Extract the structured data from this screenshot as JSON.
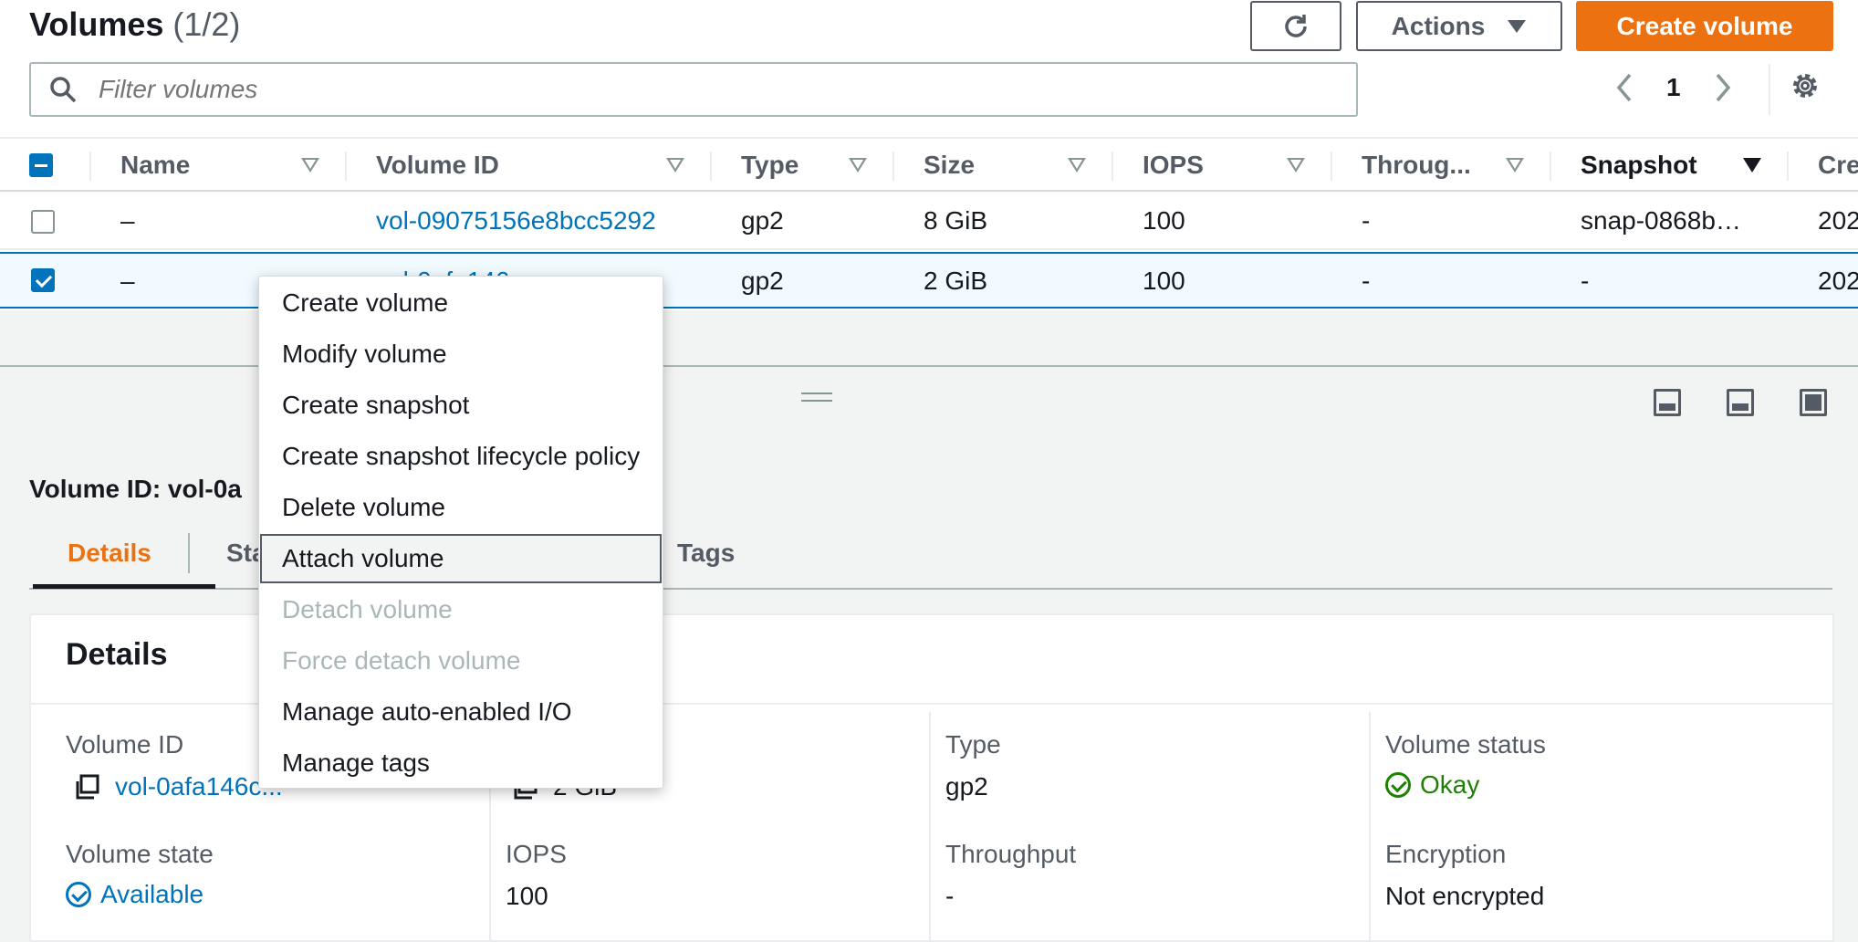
{
  "header": {
    "title": "Volumes",
    "count": "(1/2)",
    "actions_label": "Actions",
    "create_label": "Create volume"
  },
  "search": {
    "placeholder": "Filter volumes"
  },
  "pagination": {
    "page": "1"
  },
  "table": {
    "columns": [
      "Name",
      "Volume ID",
      "Type",
      "Size",
      "IOPS",
      "Throug...",
      "Snapshot",
      "Cre"
    ],
    "rows": [
      {
        "name": "–",
        "volume_id": "vol-09075156e8bcc5292",
        "type": "gp2",
        "size": "8 GiB",
        "iops": "100",
        "throughput": "-",
        "snapshot": "snap-0868b…",
        "created": "202",
        "selected": false
      },
      {
        "name": "–",
        "volume_id": "vol-0afa146c...",
        "type": "gp2",
        "size": "2 GiB",
        "iops": "100",
        "throughput": "-",
        "snapshot": "-",
        "created": "202",
        "selected": true
      }
    ]
  },
  "context_menu": {
    "items": [
      {
        "label": "Create volume",
        "state": "enabled"
      },
      {
        "label": "Modify volume",
        "state": "enabled"
      },
      {
        "label": "Create snapshot",
        "state": "enabled"
      },
      {
        "label": "Create snapshot lifecycle policy",
        "state": "enabled"
      },
      {
        "label": "Delete volume",
        "state": "enabled"
      },
      {
        "label": "Attach volume",
        "state": "hover"
      },
      {
        "label": "Detach volume",
        "state": "disabled"
      },
      {
        "label": "Force detach volume",
        "state": "disabled"
      },
      {
        "label": "Manage auto-enabled I/O",
        "state": "enabled"
      },
      {
        "label": "Manage tags",
        "state": "enabled"
      }
    ]
  },
  "details": {
    "heading": "Volume ID: vol-0a",
    "tabs": [
      "Details",
      "Sta",
      "Tags"
    ],
    "card_title": "Details",
    "fields": {
      "volume_id_label": "Volume ID",
      "volume_id_value": "vol-0afa146c...",
      "size_value": "2 GiB",
      "type_label": "Type",
      "type_value": "gp2",
      "status_label": "Volume status",
      "status_value": "Okay",
      "state_label": "Volume state",
      "state_value": "Available",
      "iops_label": "IOPS",
      "iops_value": "100",
      "throughput_label": "Throughput",
      "throughput_value": "-",
      "encryption_label": "Encryption",
      "encryption_value": "Not encrypted"
    }
  },
  "colors": {
    "accent": "#ec7211",
    "link": "#0073bb",
    "ok": "#1d8102"
  }
}
